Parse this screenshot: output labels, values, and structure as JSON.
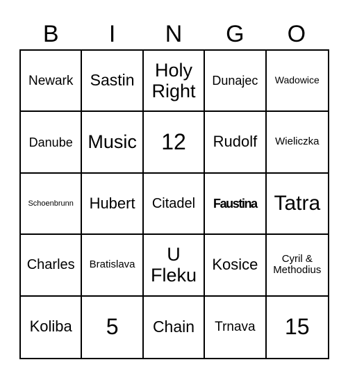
{
  "header": {
    "letters": [
      "B",
      "I",
      "N",
      "G",
      "O"
    ]
  },
  "board": {
    "rows": [
      [
        "Newark",
        "Sastin",
        "Holy Right",
        "Dunajec",
        "Wadowice"
      ],
      [
        "Danube",
        "Music",
        "12",
        "Rudolf",
        "Wieliczka"
      ],
      [
        "Schoenbrunn",
        "Hubert",
        "Citadel",
        "Faustina",
        "Tatra"
      ],
      [
        "Charles",
        "Bratislava",
        "U Fleku",
        "Kosice",
        "Cyril & Methodius"
      ],
      [
        "Koliba",
        "5",
        "Chain",
        "Trnava",
        "15"
      ]
    ]
  },
  "colors": {
    "line": "#000000",
    "background": "#ffffff",
    "text": "#000000"
  }
}
